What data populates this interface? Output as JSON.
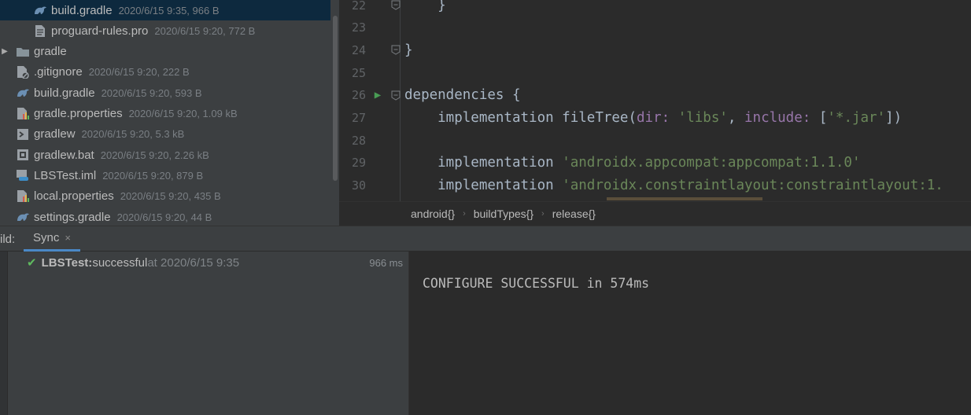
{
  "project_tree": {
    "items": [
      {
        "name": "build.gradle",
        "meta": "2020/6/15 9:35, 966 B",
        "icon": "gradle-icon",
        "selected": true
      },
      {
        "name": "proguard-rules.pro",
        "meta": "2020/6/15 9:20, 772 B",
        "icon": "file-icon"
      },
      {
        "name": "gradle",
        "meta": "",
        "icon": "folder-icon"
      },
      {
        "name": ".gitignore",
        "meta": "2020/6/15 9:20, 222 B",
        "icon": "gitignore-icon"
      },
      {
        "name": "build.gradle",
        "meta": "2020/6/15 9:20, 593 B",
        "icon": "gradle-icon"
      },
      {
        "name": "gradle.properties",
        "meta": "2020/6/15 9:20, 1.09 kB",
        "icon": "properties-icon"
      },
      {
        "name": "gradlew",
        "meta": "2020/6/15 9:20, 5.3 kB",
        "icon": "script-icon"
      },
      {
        "name": "gradlew.bat",
        "meta": "2020/6/15 9:20, 2.26 kB",
        "icon": "bat-icon"
      },
      {
        "name": "LBSTest.iml",
        "meta": "2020/6/15 9:20, 879 B",
        "icon": "iml-icon"
      },
      {
        "name": "local.properties",
        "meta": "2020/6/15 9:20, 435 B",
        "icon": "properties-icon"
      },
      {
        "name": "settings.gradle",
        "meta": "2020/6/15 9:20, 44 B",
        "icon": "gradle-icon"
      }
    ]
  },
  "editor": {
    "lines": [
      {
        "no": "22",
        "text": "    }"
      },
      {
        "no": "23",
        "text": ""
      },
      {
        "no": "24",
        "text": "}"
      },
      {
        "no": "25",
        "text": ""
      },
      {
        "no": "26",
        "text": "dependencies {"
      },
      {
        "no": "27",
        "parts": [
          {
            "t": "    implementation fileTree(",
            "c": "kw"
          },
          {
            "t": "dir: ",
            "c": "par"
          },
          {
            "t": "'libs'",
            "c": "str"
          },
          {
            "t": ", ",
            "c": "kw"
          },
          {
            "t": "include: ",
            "c": "par"
          },
          {
            "t": "[",
            "c": "kw"
          },
          {
            "t": "'*.jar'",
            "c": "str"
          },
          {
            "t": "])",
            "c": "kw"
          }
        ]
      },
      {
        "no": "28",
        "text": ""
      },
      {
        "no": "29",
        "parts": [
          {
            "t": "    implementation ",
            "c": "kw"
          },
          {
            "t": "'androidx.appcompat:appcompat:1.1.0'",
            "c": "str"
          }
        ]
      },
      {
        "no": "30",
        "parts": [
          {
            "t": "    implementation ",
            "c": "kw"
          },
          {
            "t": "'androidx.constraintlayout:constraintlayout:1.",
            "c": "str"
          }
        ]
      }
    ]
  },
  "breadcrumb": [
    "android{}",
    "buildTypes{}",
    "release{}"
  ],
  "build": {
    "title": "ild:",
    "tab_label": "Sync",
    "close_glyph": "×",
    "row": {
      "project": "LBSTest:",
      "status": " successful",
      "when": " at 2020/6/15 9:35",
      "duration": "966 ms"
    },
    "console": "CONFIGURE SUCCESSFUL in 574ms"
  },
  "colors": {
    "string": "#6a8759",
    "param": "#9876aa",
    "success": "#5fb95f",
    "selection": "#0d293e"
  }
}
